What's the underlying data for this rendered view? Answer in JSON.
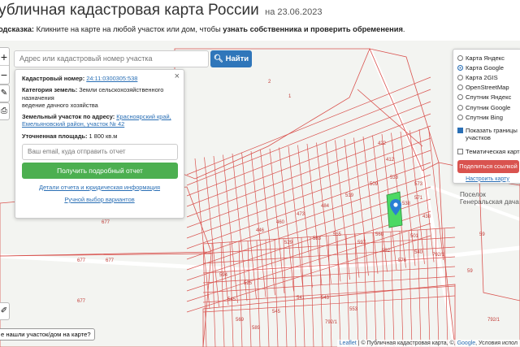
{
  "header": {
    "title": "убличная кадастровая карта России",
    "date": "на 23.06.2023",
    "hint_label": "одсказка:",
    "hint_text": " Кликните на карте на любой участок или дом, чтобы ",
    "hint_bold": "узнать собственника и проверить обременения",
    "hint_end": "."
  },
  "map_controls": {
    "zoom_in": "+",
    "zoom_out": "−",
    "search_placeholder": "Адрес или кадастровый номер участка",
    "search_button": "Найти",
    "search_icon": "magnifier-icon"
  },
  "info_panel": {
    "close": "×",
    "cadastral_label": "Кадастровый номер:",
    "cadastral_value": "24:11:0300305:538",
    "category_label": "Категория земель:",
    "category_value": "Земли сельскохозяйственного назначения",
    "use_value": "ведение дачного хозяйства",
    "address_label": "Земельный участок по адресу:",
    "address_value": "Красноярский край, Емельяновский район, участок № 42",
    "area_label": "Уточненная площадь:",
    "area_value": "1 800 кв.м",
    "email_placeholder": "Ваш email, куда отправить отчет",
    "report_button": "Получить подробный отчет",
    "details_link": "Детали отчета и юридическая информация",
    "manual_link": "Ручной выбор вариантов"
  },
  "layers_panel": {
    "options": [
      {
        "label": "Карта Яндекс",
        "checked": false
      },
      {
        "label": "Карта Google",
        "checked": true
      },
      {
        "label": "Карта 2GIS",
        "checked": false
      },
      {
        "label": "OpenStreetMap",
        "checked": false
      },
      {
        "label": "Спутник Яндекс",
        "checked": false
      },
      {
        "label": "Спутник Google",
        "checked": false
      },
      {
        "label": "Спутник Bing",
        "checked": false
      }
    ],
    "show_borders": "Показать границы участков",
    "thematic": "Тематическая карта",
    "share_button": "Поделиться ссылкой",
    "setup_link": "Настроить карту"
  },
  "map_labels": {
    "poi_line1": "Поселок",
    "poi_line2": "Генеральская дача",
    "parcels": [
      "677",
      "677",
      "677",
      "677",
      "677",
      "1",
      "2",
      "792/1",
      "792/1",
      "792/1",
      "59",
      "59",
      "538",
      "576",
      "540",
      "553",
      "543",
      "541",
      "545",
      "422",
      "412",
      "573",
      "571",
      "592",
      "560",
      "597",
      "555",
      "583",
      "529",
      "533",
      "509",
      "519",
      "484",
      "473",
      "460",
      "446",
      "438",
      "501",
      "525",
      "545",
      "569",
      "589",
      "594"
    ]
  },
  "footer": {
    "not_found": "е нашли участок/дом на карте?",
    "attribution_leaflet": "Leaflet",
    "attribution_text": " | © Публичная кадастровая карта, ©, ",
    "attribution_google": "Google",
    "attribution_end": ", Условия испол"
  },
  "colors": {
    "parcel_border": "#d9534f",
    "selected_parcel": "#4cd964",
    "road": "#ffffff",
    "primary": "#2f76ba",
    "success": "#4caf50",
    "danger": "#d9534f"
  }
}
